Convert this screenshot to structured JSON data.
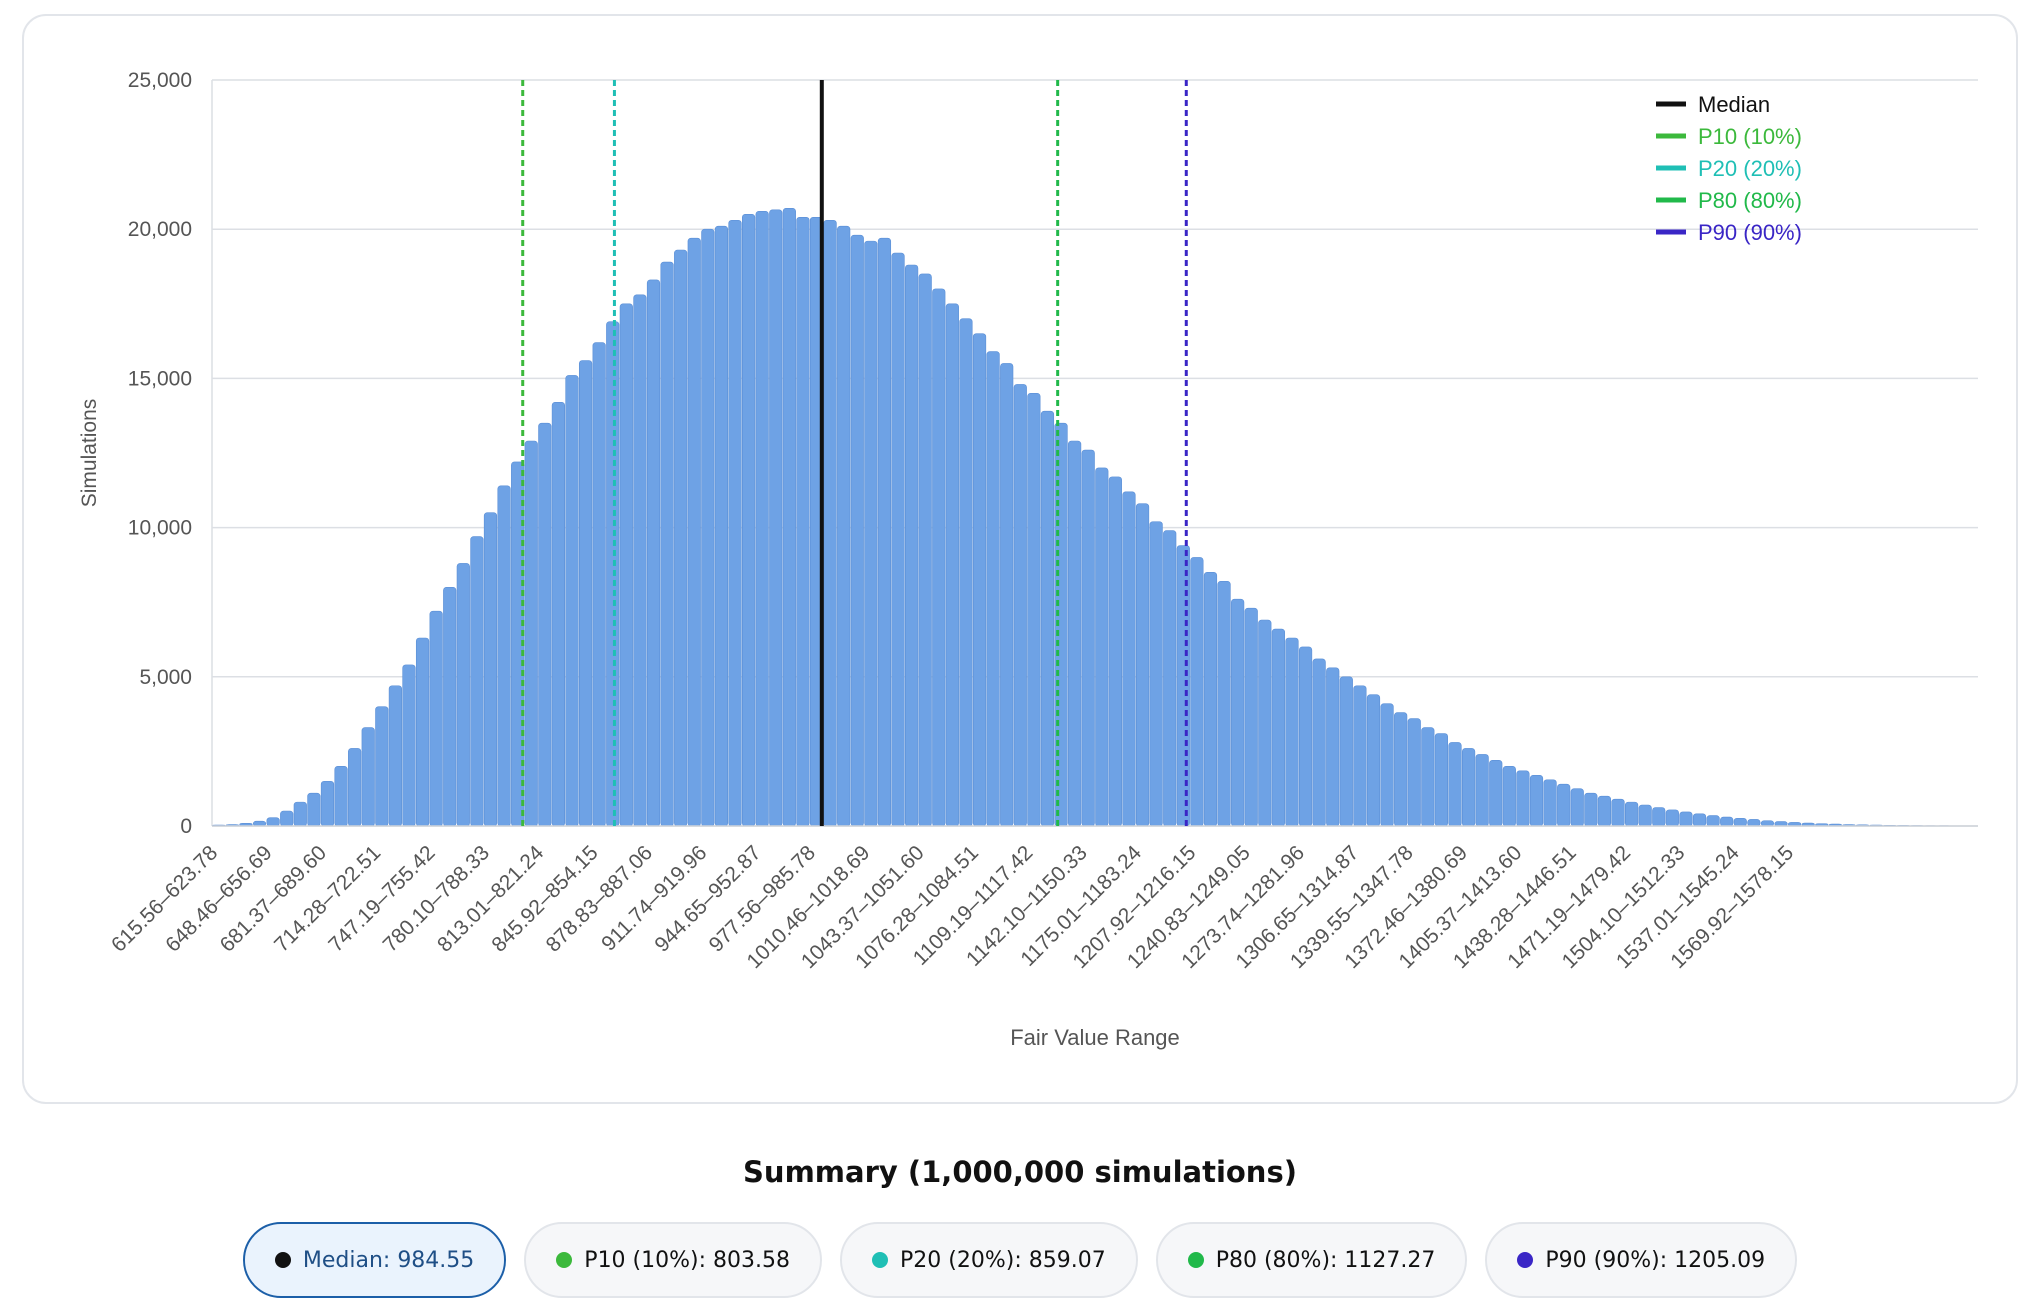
{
  "chart_data": {
    "type": "bar",
    "ylabel": "Simulations",
    "xlabel": "Fair Value Range",
    "ylim": [
      0,
      25000
    ],
    "y_ticks": [
      0,
      5000,
      10000,
      15000,
      20000,
      25000
    ],
    "y_tick_labels": [
      "0",
      "5,000",
      "10,000",
      "15,000",
      "20,000",
      "25,000"
    ],
    "bin_start": 615.56,
    "bin_width": 8.22,
    "x_tick_labels": [
      "615.56–623.78",
      "648.46–656.69",
      "681.37–689.60",
      "714.28–722.51",
      "747.19–755.42",
      "780.10–788.33",
      "813.01–821.24",
      "845.92–854.15",
      "878.83–887.06",
      "911.74–919.96",
      "944.65–952.87",
      "977.56–985.78",
      "1010.46–1018.69",
      "1043.37–1051.60",
      "1076.28–1084.51",
      "1109.19–1117.42",
      "1142.10–1150.33",
      "1175.01–1183.24",
      "1207.92–1216.15",
      "1240.83–1249.05",
      "1273.74–1281.96",
      "1306.65–1314.87",
      "1339.55–1347.78",
      "1372.46–1380.69",
      "1405.37–1413.60",
      "1438.28–1446.51",
      "1471.19–1479.42",
      "1504.10–1512.33",
      "1537.01–1545.24",
      "1569.92–1578.15"
    ],
    "values": [
      30,
      50,
      90,
      160,
      280,
      500,
      800,
      1100,
      1500,
      2000,
      2600,
      3300,
      4000,
      4700,
      5400,
      6300,
      7200,
      8000,
      8800,
      9700,
      10500,
      11400,
      12200,
      12900,
      13500,
      14200,
      15100,
      15600,
      16200,
      16900,
      17500,
      17800,
      18300,
      18900,
      19300,
      19700,
      20000,
      20100,
      20300,
      20500,
      20600,
      20650,
      20700,
      20400,
      20400,
      20300,
      20100,
      19800,
      19600,
      19700,
      19200,
      18800,
      18500,
      18000,
      17500,
      17000,
      16500,
      15900,
      15500,
      14800,
      14500,
      13900,
      13500,
      12900,
      12600,
      12000,
      11700,
      11200,
      10800,
      10200,
      9900,
      9400,
      9000,
      8500,
      8200,
      7600,
      7300,
      6900,
      6600,
      6300,
      6000,
      5600,
      5300,
      5000,
      4700,
      4400,
      4100,
      3800,
      3600,
      3300,
      3100,
      2800,
      2600,
      2400,
      2200,
      2000,
      1850,
      1700,
      1550,
      1400,
      1250,
      1100,
      1000,
      900,
      800,
      700,
      620,
      540,
      470,
      410,
      350,
      300,
      260,
      220,
      180,
      150,
      120,
      100,
      80,
      65,
      50,
      40,
      30,
      25,
      20,
      15,
      10,
      10,
      5,
      5
    ],
    "percentiles": [
      {
        "label": "Median",
        "value": 984.55,
        "color": "#111111",
        "dashed": false
      },
      {
        "label": "P10 (10%)",
        "value": 803.58,
        "color": "#3cb93c",
        "dashed": true
      },
      {
        "label": "P20 (20%)",
        "value": 859.07,
        "color": "#1fbfb5",
        "dashed": true
      },
      {
        "label": "P80 (80%)",
        "value": 1127.27,
        "color": "#21b94a",
        "dashed": true
      },
      {
        "label": "P90 (90%)",
        "value": 1205.09,
        "color": "#3a26c6",
        "dashed": true
      }
    ],
    "bar_color": "#6ea2e5",
    "legend_position": "top-right",
    "grid": true
  },
  "summary": {
    "title": "Summary (1,000,000 simulations)",
    "pills": [
      {
        "label": "Median: 984.55",
        "color": "#111111",
        "active": true
      },
      {
        "label": "P10 (10%): 803.58",
        "color": "#3cb93c",
        "active": false
      },
      {
        "label": "P20 (20%): 859.07",
        "color": "#1fbfb5",
        "active": false
      },
      {
        "label": "P80 (80%): 1127.27",
        "color": "#21b94a",
        "active": false
      },
      {
        "label": "P90 (90%): 1205.09",
        "color": "#3a26c6",
        "active": false
      }
    ]
  }
}
